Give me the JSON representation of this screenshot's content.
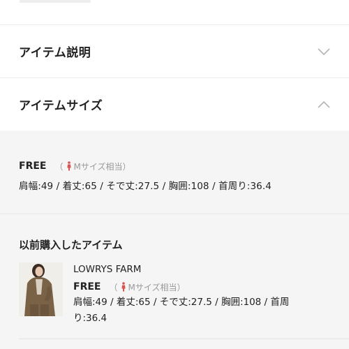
{
  "sections": {
    "description": {
      "title": "アイテム説明",
      "expanded": false
    },
    "size": {
      "title": "アイテムサイズ",
      "expanded": true
    }
  },
  "size_info": {
    "size": "FREE",
    "note": "（ Mサイズ相当）",
    "note_open": "（",
    "note_text": "Mサイズ相当）",
    "measurements": "肩幅:49 / 着丈:65 / そで丈:27.5 / 胸囲:108 / 首周り:36.4"
  },
  "previous": {
    "title": "以前購入したアイテム",
    "item": {
      "brand": "LOWRYS FARM",
      "size": "FREE",
      "note_open": "（",
      "note_text": "Mサイズ相当）",
      "measurements_line1": "肩幅:49 / 着丈:65 / そで丈:27.5 / 胸囲:108 / 首周",
      "measurements_line2": "り:36.4"
    }
  },
  "colors": {
    "panel_bg": "#f5f5f5",
    "accent_icon": "#d9534f",
    "muted": "#999999"
  },
  "icons": {
    "collapsed": "chevron-down-icon",
    "expanded": "chevron-up-icon",
    "size_reference": "woman-icon"
  }
}
